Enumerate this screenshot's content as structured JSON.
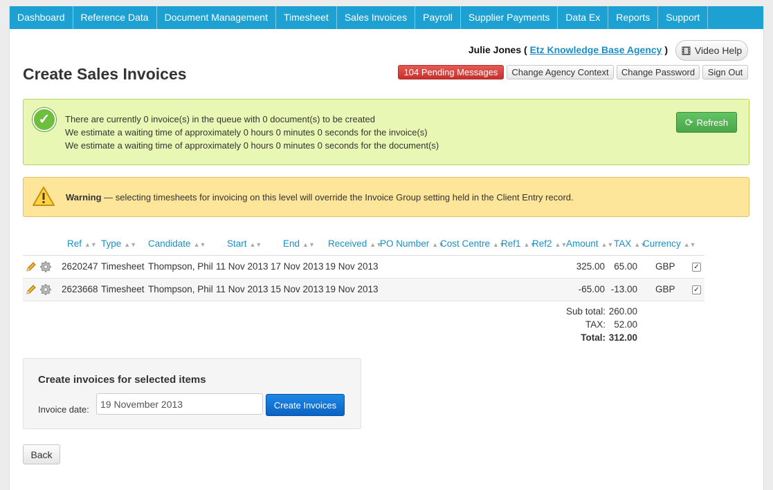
{
  "nav": {
    "items": [
      "Dashboard",
      "Reference Data",
      "Document Management",
      "Timesheet",
      "Sales Invoices",
      "Payroll",
      "Supplier Payments",
      "Data Ex",
      "Reports",
      "Support"
    ]
  },
  "header": {
    "user_name": "Julie Jones",
    "paren_open": "(",
    "agency_link": "Etz Knowledge Base Agency",
    "paren_close": ")",
    "video_help": "Video Help",
    "pending_messages": "104 Pending Messages",
    "change_agency": "Change Agency Context",
    "change_password": "Change Password",
    "sign_out": "Sign Out",
    "page_title": "Create Sales Invoices"
  },
  "queue_alert": {
    "lines": [
      "There are currently 0 invoice(s) in the queue with 0 document(s) to be created",
      "We estimate a waiting time of approximately 0 hours 0 minutes 0 seconds for the invoice(s)",
      "We estimate a waiting time of approximately 0 hours 0 minutes 0 seconds for the document(s)"
    ],
    "refresh_label": "Refresh"
  },
  "warning": {
    "bold": "Warning",
    "text": " — selecting timesheets for invoicing on this level will override the Invoice Group setting held in the Client Entry record."
  },
  "table": {
    "columns": [
      "Ref",
      "Type",
      "Candidate",
      "Start",
      "End",
      "Received",
      "PO Number",
      "Cost Centre",
      "Ref1",
      "Ref2",
      "Amount",
      "TAX",
      "Currency"
    ],
    "rows": [
      {
        "ref": "2620247",
        "type": "Timesheet",
        "candidate": "Thompson, Phil",
        "start": "11 Nov 2013",
        "end": "17 Nov 2013",
        "received": "19 Nov 2013",
        "po_number": "",
        "cost_centre": "",
        "ref1": "",
        "ref2": "",
        "amount": "325.00",
        "tax": "65.00",
        "currency": "GBP",
        "selected": true
      },
      {
        "ref": "2623668",
        "type": "Timesheet",
        "candidate": "Thompson, Phil",
        "start": "11 Nov 2013",
        "end": "15 Nov 2013",
        "received": "19 Nov 2013",
        "po_number": "",
        "cost_centre": "",
        "ref1": "",
        "ref2": "",
        "amount": "-65.00",
        "tax": "-13.00",
        "currency": "GBP",
        "selected": true
      }
    ]
  },
  "totals": {
    "subtotal_label": "Sub total:",
    "subtotal": "260.00",
    "tax_label": "TAX:",
    "tax": "52.00",
    "total_label": "Total:",
    "total": "312.00"
  },
  "create_panel": {
    "title": "Create invoices for selected items",
    "date_label": "Invoice date:",
    "date_value": "19 November 2013",
    "button": "Create Invoices"
  },
  "back_button": "Back",
  "colors": {
    "nav": "#1da0d2",
    "pending_badge": "#d9413d",
    "refresh": "#5cb85c",
    "success_bg": "#e9f7b4",
    "warning_bg": "#fde59a",
    "primary": "#0a62c2"
  }
}
